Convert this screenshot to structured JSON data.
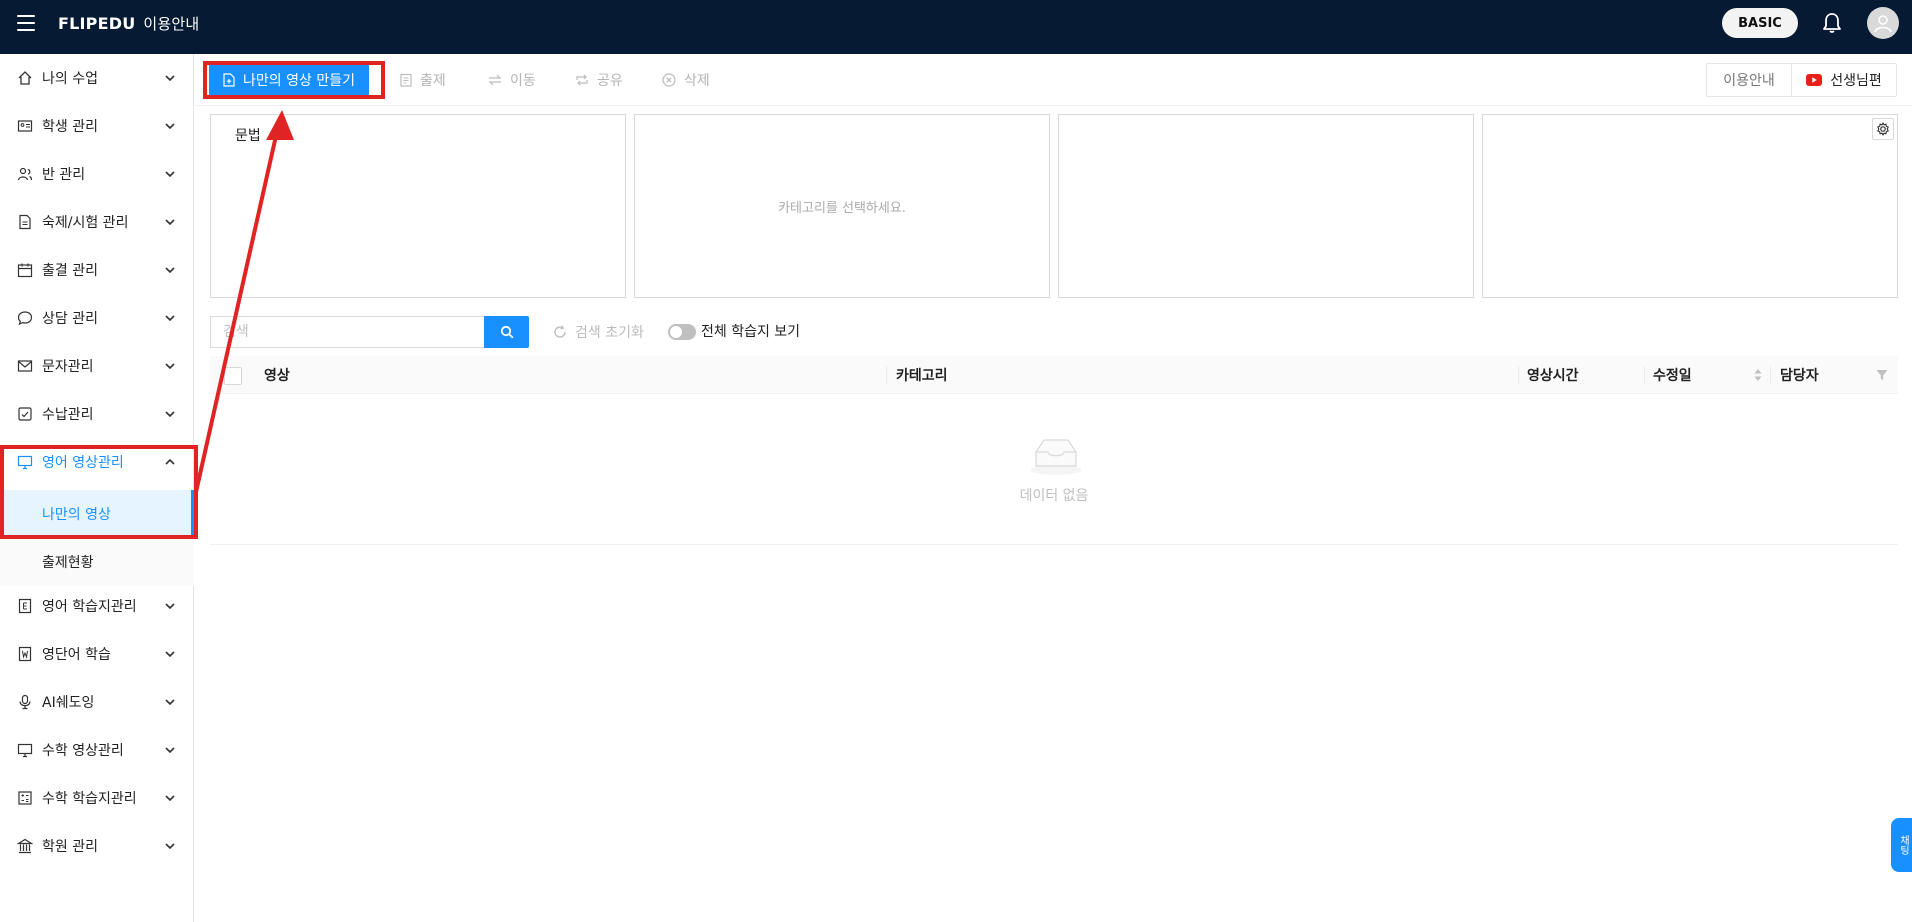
{
  "header": {
    "brand": "FLIPEDU",
    "guide": "이용안내",
    "plan_badge": "BASIC",
    "icons": {
      "menu": "hamburger-icon",
      "notification": "bell-icon",
      "profile": "avatar-icon"
    }
  },
  "sidebar": {
    "items": [
      {
        "label": "나의 수업",
        "icon": "home-icon"
      },
      {
        "label": "학생 관리",
        "icon": "id-card-icon"
      },
      {
        "label": "반 관리",
        "icon": "users-icon"
      },
      {
        "label": "숙제/시험 관리",
        "icon": "document-icon"
      },
      {
        "label": "출결 관리",
        "icon": "calendar-icon"
      },
      {
        "label": "상담 관리",
        "icon": "chat-icon"
      },
      {
        "label": "문자관리",
        "icon": "mail-icon"
      },
      {
        "label": "수납관리",
        "icon": "receipt-icon"
      },
      {
        "label": "영어 영상관리",
        "icon": "monitor-icon",
        "expanded": true
      },
      {
        "label": "영어 학습지관리",
        "icon": "book-icon"
      },
      {
        "label": "영단어 학습",
        "icon": "wordbook-icon"
      },
      {
        "label": "AI쉐도잉",
        "icon": "microphone-icon"
      },
      {
        "label": "수학 영상관리",
        "icon": "monitor-icon"
      },
      {
        "label": "수학 학습지관리",
        "icon": "calculator-icon"
      },
      {
        "label": "학원 관리",
        "icon": "building-icon"
      }
    ],
    "sub_items": [
      {
        "label": "나만의 영상",
        "selected": true
      },
      {
        "label": "출제현황",
        "selected": false
      }
    ]
  },
  "toolbar": {
    "create_label": "나만의 영상 만들기",
    "assign_label": "출제",
    "move_label": "이동",
    "share_label": "공유",
    "delete_label": "삭제",
    "guide_label": "이용안내",
    "teacher_label": "선생님편"
  },
  "category_panels": {
    "first_label": "문법",
    "placeholder": "카테고리를 선택하세요."
  },
  "search": {
    "placeholder": "검색",
    "reset_label": "검색 초기화",
    "toggle_label": "전체 학습지 보기",
    "toggle_on": false
  },
  "table": {
    "columns": [
      "영상",
      "카테고리",
      "영상시간",
      "수정일",
      "담당자"
    ],
    "rows": [],
    "empty_text": "데이터 없음"
  },
  "floating_tab": {
    "label": "채팅"
  },
  "colors": {
    "header_bg": "#061a33",
    "accent": "#1890ff",
    "annotation": "#e02424"
  }
}
